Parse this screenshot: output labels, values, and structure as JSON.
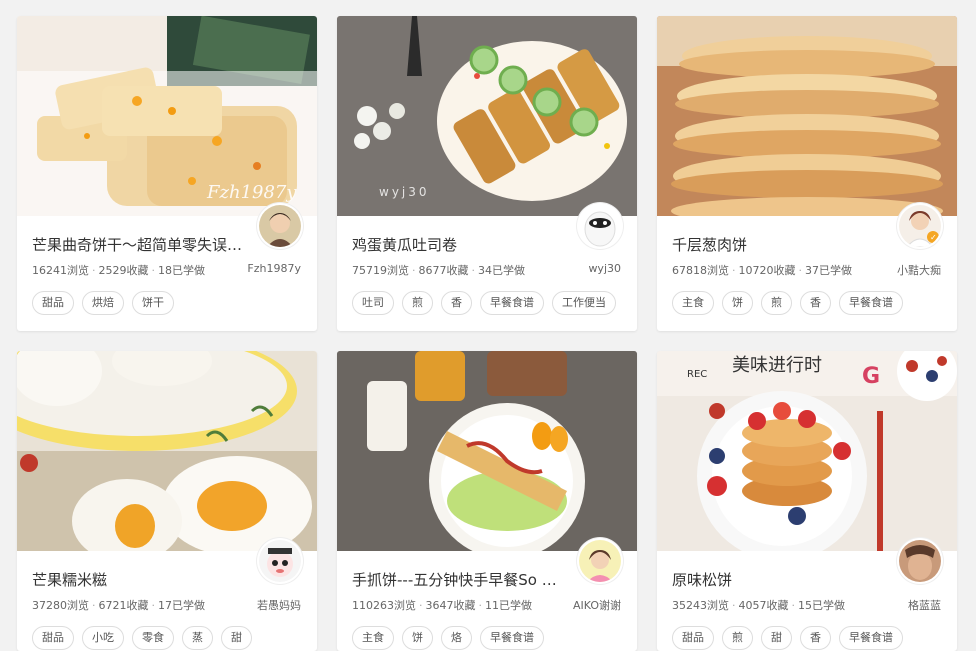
{
  "recipes": [
    {
      "title": "芒果曲奇饼干～超简单零失误…",
      "views": "16241浏览",
      "collects": "2529收藏",
      "learned": "18已学做",
      "author": "Fzh1987y",
      "watermark": "Fzh1987y",
      "tags": [
        "甜品",
        "烘焙",
        "饼干"
      ]
    },
    {
      "title": "鸡蛋黄瓜吐司卷",
      "views": "75719浏览",
      "collects": "8677收藏",
      "learned": "34已学做",
      "author": "wyj30",
      "watermark": "wyj30",
      "tags": [
        "吐司",
        "煎",
        "香",
        "早餐食谱",
        "工作便当"
      ]
    },
    {
      "title": "千层葱肉饼",
      "views": "67818浏览",
      "collects": "10720收藏",
      "learned": "37已学做",
      "author": "小黠大痴",
      "tags": [
        "主食",
        "饼",
        "煎",
        "香",
        "早餐食谱"
      ]
    },
    {
      "title": "芒果糯米糍",
      "views": "37280浏览",
      "collects": "6721收藏",
      "learned": "17已学做",
      "author": "若愚妈妈",
      "tags": [
        "甜品",
        "小吃",
        "零食",
        "蒸",
        "甜"
      ]
    },
    {
      "title": "手抓饼---五分钟快手早餐So …",
      "views": "110263浏览",
      "collects": "3647收藏",
      "learned": "11已学做",
      "author": "AIKO谢谢",
      "tags": [
        "主食",
        "饼",
        "烙",
        "早餐食谱"
      ]
    },
    {
      "title": "原味松饼",
      "views": "35243浏览",
      "collects": "4057收藏",
      "learned": "15已学做",
      "author": "格蓝蓝",
      "photo_text": {
        "rec": "REC",
        "overlay": "美味进行时",
        "letter": "G"
      },
      "tags": [
        "甜品",
        "煎",
        "甜",
        "香",
        "早餐食谱"
      ]
    }
  ],
  "stat_separator": "·"
}
